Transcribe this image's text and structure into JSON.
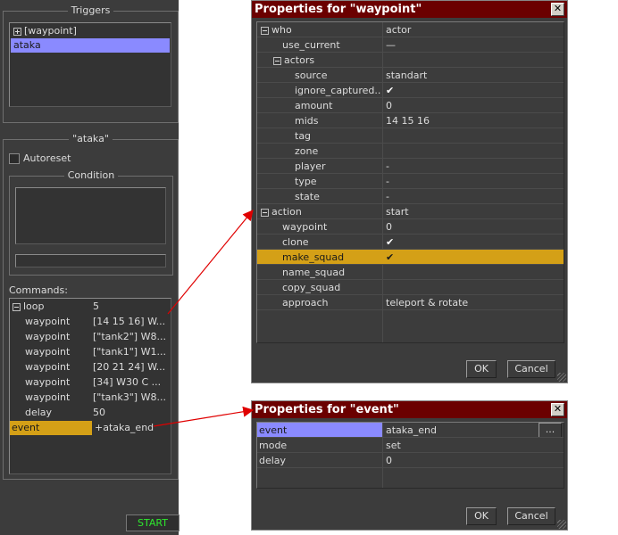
{
  "left_panel": {
    "triggers_title": "Triggers",
    "triggers": [
      {
        "label": "[waypoint]",
        "expandable": true
      },
      {
        "label": "ataka",
        "selected": true
      }
    ],
    "selected_title": "\"ataka\"",
    "autoreset_label": "Autoreset",
    "condition_title": "Condition",
    "commands_label": "Commands:",
    "commands": [
      {
        "name": "loop",
        "value": "5",
        "expandable": true
      },
      {
        "name": "waypoint",
        "value": "[14 15 16] W..."
      },
      {
        "name": "waypoint",
        "value": "[\"tank2\"] W8..."
      },
      {
        "name": "waypoint",
        "value": "[\"tank1\"] W1..."
      },
      {
        "name": "waypoint",
        "value": "[20 21 24] W..."
      },
      {
        "name": "waypoint",
        "value": "[34] W30 C ..."
      },
      {
        "name": "waypoint",
        "value": "[\"tank3\"] W8..."
      },
      {
        "name": "delay",
        "value": "50"
      },
      {
        "name": "event",
        "value": "+ataka_end",
        "selected": true
      }
    ],
    "start_label": "START"
  },
  "waypoint_dialog": {
    "title": "Properties for \"waypoint\"",
    "close_glyph": "✕",
    "rows": [
      {
        "name": "who",
        "value": "actor",
        "indent": 0,
        "expander": "minus"
      },
      {
        "name": "use_current",
        "value": "—",
        "indent": 1
      },
      {
        "name": "actors",
        "value": "",
        "indent": 1,
        "expander": "minus"
      },
      {
        "name": "source",
        "value": "standart",
        "indent": 2
      },
      {
        "name": "ignore_captured..",
        "value": "✔",
        "indent": 2
      },
      {
        "name": "amount",
        "value": "0",
        "indent": 2
      },
      {
        "name": "mids",
        "value": "14 15 16",
        "indent": 2
      },
      {
        "name": "tag",
        "value": "",
        "indent": 2
      },
      {
        "name": "zone",
        "value": "",
        "indent": 2
      },
      {
        "name": "player",
        "value": "-",
        "indent": 2
      },
      {
        "name": "type",
        "value": "-",
        "indent": 2
      },
      {
        "name": "state",
        "value": "-",
        "indent": 2
      },
      {
        "name": "action",
        "value": "start",
        "indent": 0,
        "expander": "minus"
      },
      {
        "name": "waypoint",
        "value": "0",
        "indent": 1
      },
      {
        "name": "clone",
        "value": "✔",
        "indent": 1
      },
      {
        "name": "make_squad",
        "value": "✔",
        "indent": 1,
        "selected": true
      },
      {
        "name": "name_squad",
        "value": "",
        "indent": 1
      },
      {
        "name": "copy_squad",
        "value": "",
        "indent": 1
      },
      {
        "name": "approach",
        "value": "teleport & rotate",
        "indent": 1
      }
    ],
    "ok_label": "OK",
    "cancel_label": "Cancel"
  },
  "event_dialog": {
    "title": "Properties for \"event\"",
    "close_glyph": "✕",
    "rows": [
      {
        "name": "event",
        "value": "ataka_end",
        "selected": true
      },
      {
        "name": "mode",
        "value": "set"
      },
      {
        "name": "delay",
        "value": "0"
      }
    ],
    "browse_label": "...",
    "ok_label": "OK",
    "cancel_label": "Cancel"
  },
  "colors": {
    "panel": "#3c3c3c",
    "titlebar": "#6b0000",
    "select_blue": "#8a8aff",
    "select_gold": "#d4a017",
    "start_text": "#2ee82e",
    "arrow": "#e00000"
  }
}
